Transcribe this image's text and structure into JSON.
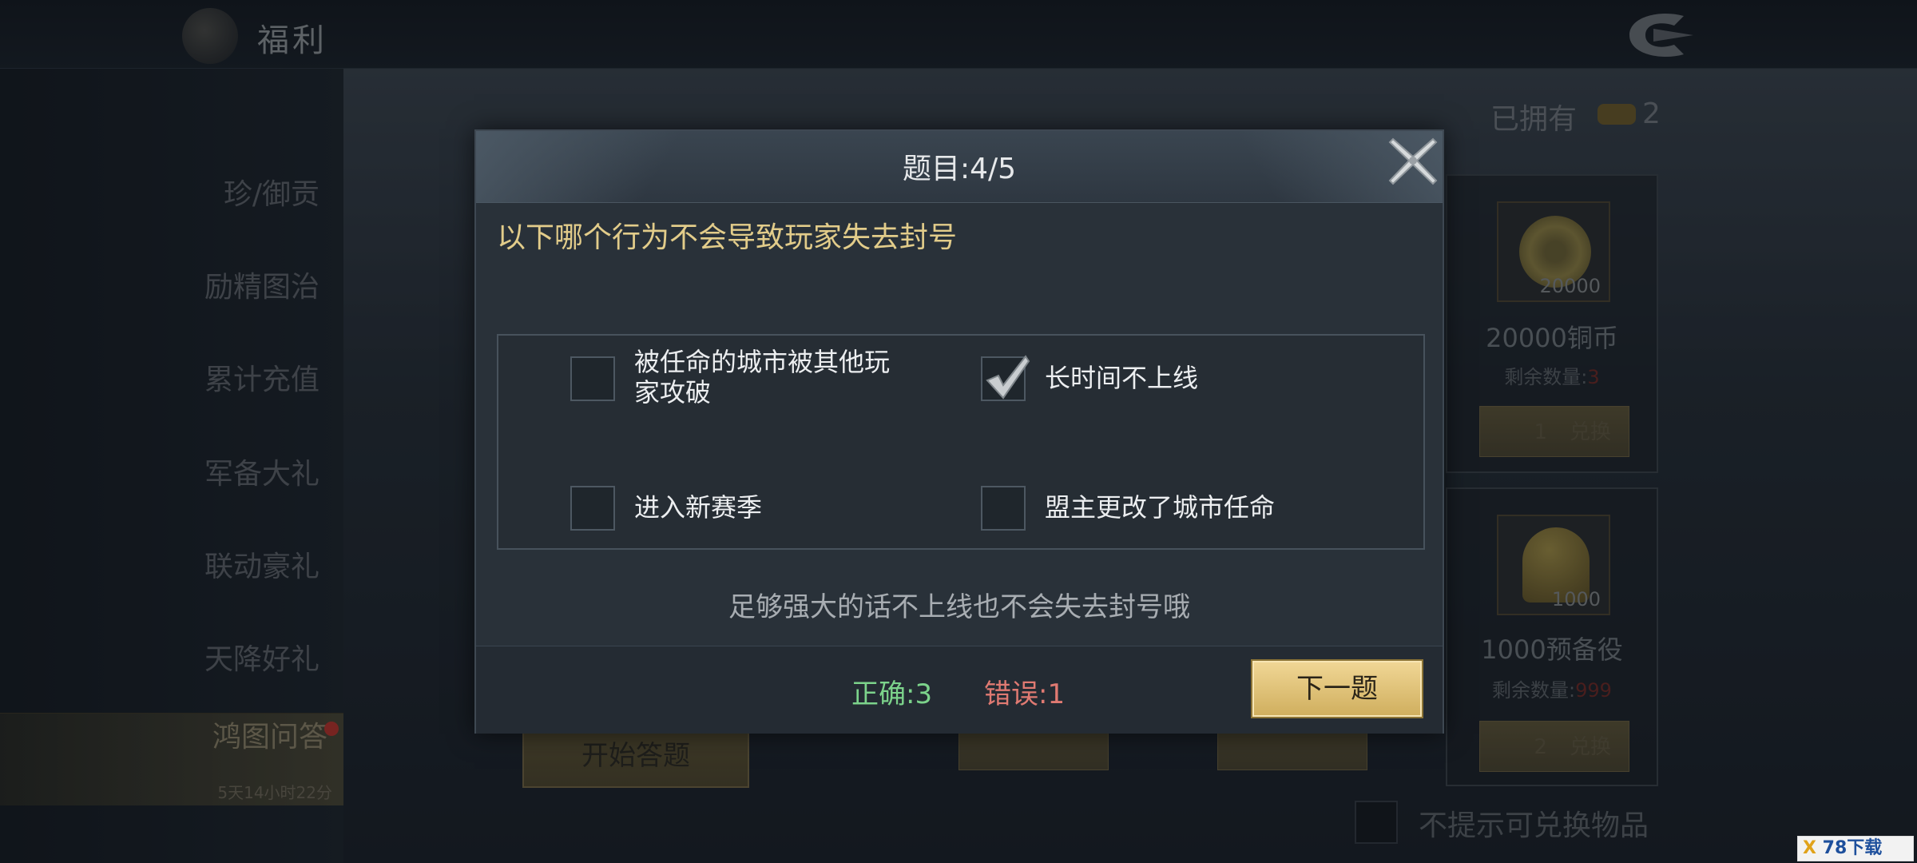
{
  "header": {
    "title": "福利"
  },
  "sidebar": {
    "items": [
      {
        "label": "珍/御贡"
      },
      {
        "label": "励精图治"
      },
      {
        "label": "累计充值"
      },
      {
        "label": "军备大礼"
      },
      {
        "label": "联动豪礼"
      },
      {
        "label": "天降好礼"
      },
      {
        "label": "鸿图问答",
        "timer": "5天14小时22分"
      }
    ]
  },
  "shop": {
    "owned_label": "已拥有",
    "owned_count": "2",
    "cards": [
      {
        "icon": "copper-coin-icon",
        "icon_count": "20000",
        "name": "20000铜币",
        "remain_label": "剩余数量:",
        "remain_value": "3",
        "cost": "1",
        "btn": "兑换"
      },
      {
        "icon": "helmet-icon",
        "icon_count": "1000",
        "name": "1000预备役",
        "remain_label": "剩余数量:",
        "remain_value": "999",
        "cost": "2",
        "btn": "兑换"
      }
    ],
    "start_button": "开始答题",
    "no_prompt_label": "不提示可兑换物品"
  },
  "quiz": {
    "title": "题目:4/5",
    "question": "以下哪个行为不会导致玩家失去封号",
    "options": [
      {
        "text_line1": "被任命的城市被其他玩",
        "text_line2": "家攻破",
        "checked": false
      },
      {
        "text_line1": "长时间不上线",
        "checked": true
      },
      {
        "text_line1": "进入新赛季",
        "checked": false
      },
      {
        "text_line1": "盟主更改了城市任命",
        "checked": false
      }
    ],
    "hint": "足够强大的话不上线也不会失去封号哦",
    "correct_label": "正确:3",
    "wrong_label": "错误:1",
    "next_button": "下一题"
  },
  "watermark": {
    "mark": "X",
    "text": "78下载"
  },
  "colors": {
    "accent_gold": "#e2cc8a",
    "correct": "#7cd38b",
    "wrong": "#e07a72",
    "button_gold": "#e6c77d"
  }
}
